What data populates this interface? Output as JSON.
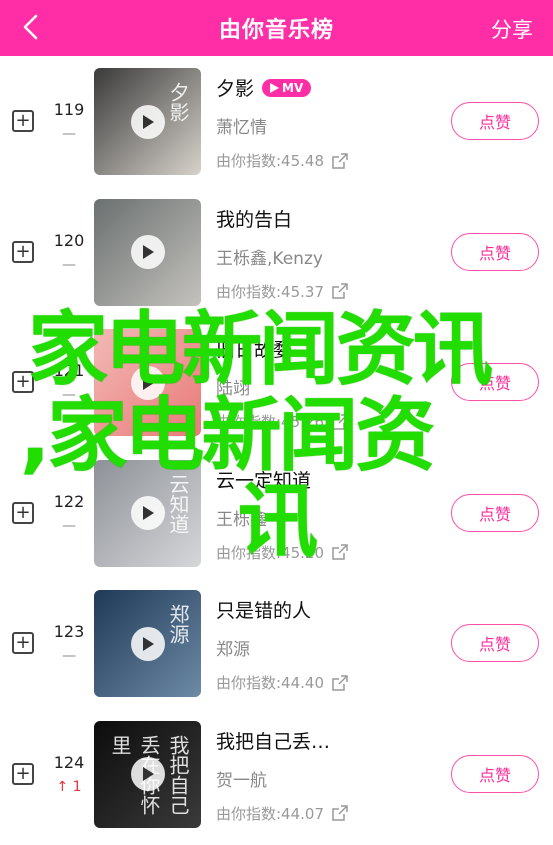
{
  "header": {
    "title": "由你音乐榜",
    "share_label": "分享"
  },
  "overlay": {
    "line1": "家电新闻资讯",
    "line2": ",家电新闻资",
    "line3": "讯"
  },
  "rows": [
    {
      "rank": "119",
      "trend": "—",
      "trend_type": "flat",
      "song": "夕影",
      "mv": "MV",
      "artist": "萧忆情",
      "index": "由你指数:45.48",
      "like_label": "点赞",
      "cover_colors": [
        "#3a3a3a",
        "#d7d2cb"
      ],
      "cover_text": "夕影"
    },
    {
      "rank": "120",
      "trend": "—",
      "trend_type": "flat",
      "song": "我的告白",
      "artist": "王栎鑫,Kenzy",
      "index": "由你指数:45.37",
      "like_label": "点赞",
      "cover_colors": [
        "#6a7070",
        "#c4c2bd"
      ],
      "cover_text": ""
    },
    {
      "rank": "121",
      "trend": "—",
      "trend_type": "flat",
      "song": "旧日故婺",
      "artist": "陆翊",
      "index": "由你指数:45.26",
      "like_label": "点赞",
      "cover_colors": [
        "#f2b9b6",
        "#e97a78"
      ],
      "cover_text": ""
    },
    {
      "rank": "122",
      "trend": "—",
      "trend_type": "flat",
      "song": "云一定知道",
      "artist": "王栎鑫",
      "index": "由你指数:45.20",
      "like_label": "点赞",
      "cover_colors": [
        "#8d9197",
        "#d6d7da"
      ],
      "cover_text": "云知道"
    },
    {
      "rank": "123",
      "trend": "—",
      "trend_type": "flat",
      "song": "只是错的人",
      "artist": "郑源",
      "index": "由你指数:44.40",
      "like_label": "点赞",
      "cover_colors": [
        "#1f3a57",
        "#6d8aa6"
      ],
      "cover_text": "郑源"
    },
    {
      "rank": "124",
      "trend": "↑ 1",
      "trend_type": "up",
      "song": "我把自己丢…",
      "artist": "贺一航",
      "index": "由你指数:44.07",
      "like_label": "点赞",
      "cover_colors": [
        "#0c0c0c",
        "#3a3a3a"
      ],
      "cover_text": "我把自己丢在你怀里"
    }
  ]
}
